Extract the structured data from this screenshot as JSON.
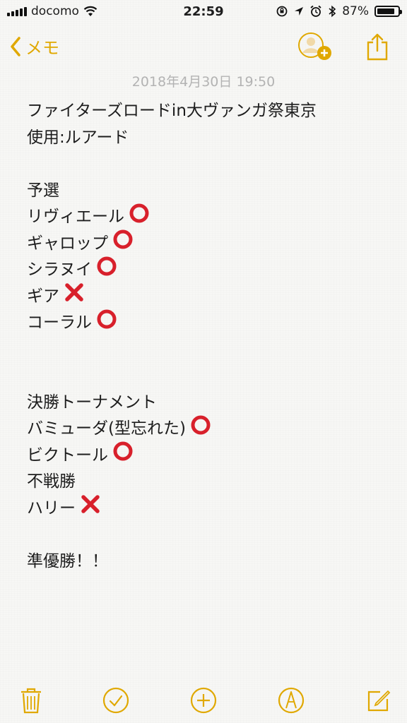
{
  "status_bar": {
    "carrier": "docomo",
    "time": "22:59",
    "battery": "87%",
    "battery_level": 0.87
  },
  "nav": {
    "back_label": "メモ"
  },
  "note": {
    "date": "2018年4月30日 19:50",
    "lines": [
      {
        "text": "ファイターズロードin大ヴァンガ祭東京",
        "mark": ""
      },
      {
        "text": "使用:ルアード",
        "mark": ""
      },
      {
        "text": "",
        "mark": ""
      },
      {
        "text": "予選",
        "mark": ""
      },
      {
        "text": "リヴィエール",
        "mark": "circle"
      },
      {
        "text": "ギャロップ",
        "mark": "circle"
      },
      {
        "text": "シラヌイ",
        "mark": "circle"
      },
      {
        "text": "ギア",
        "mark": "cross"
      },
      {
        "text": "コーラル",
        "mark": "circle"
      },
      {
        "text": "",
        "mark": ""
      },
      {
        "text": "",
        "mark": ""
      },
      {
        "text": "決勝トーナメント",
        "mark": ""
      },
      {
        "text": "バミューダ(型忘れた)",
        "mark": "circle"
      },
      {
        "text": "ビクトール",
        "mark": "circle"
      },
      {
        "text": "不戦勝",
        "mark": ""
      },
      {
        "text": "ハリー",
        "mark": "cross"
      },
      {
        "text": "",
        "mark": ""
      },
      {
        "text": "準優勝！！",
        "mark": ""
      }
    ]
  },
  "colors": {
    "accent": "#e0a800",
    "circle": "#d8202b",
    "cross": "#d8202b",
    "date": "#b3b3b3"
  }
}
